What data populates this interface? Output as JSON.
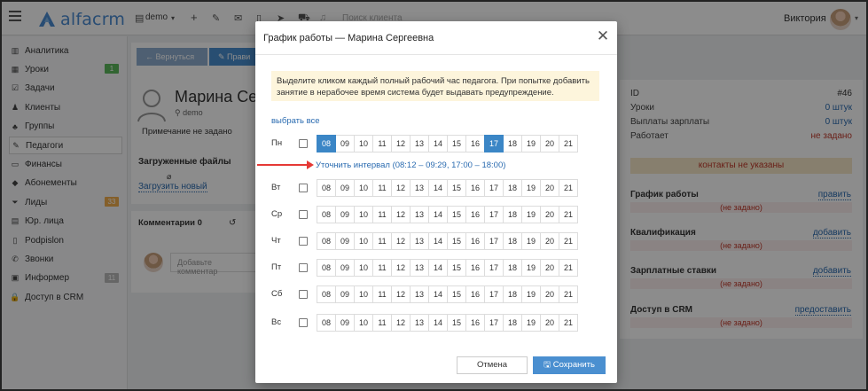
{
  "topbar": {
    "logo_text": "alfacrm",
    "branch": "demo",
    "search_placeholder": "Поиск клиента",
    "user_name": "Виктория"
  },
  "sidebar": {
    "items": [
      {
        "label": "Аналитика",
        "icon": "chart-icon"
      },
      {
        "label": "Уроки",
        "icon": "calendar-icon",
        "badge": "1",
        "badge_color": "#5cb85c"
      },
      {
        "label": "Задачи",
        "icon": "tasks-icon"
      },
      {
        "label": "Клиенты",
        "icon": "user-icon"
      },
      {
        "label": "Группы",
        "icon": "group-icon"
      },
      {
        "label": "Педагоги",
        "icon": "teacher-icon",
        "active": true
      },
      {
        "label": "Финансы",
        "icon": "money-icon"
      },
      {
        "label": "Абонементы",
        "icon": "tag-icon"
      },
      {
        "label": "Лиды",
        "icon": "funnel-icon",
        "badge": "33",
        "badge_color": "#f0ad4e"
      },
      {
        "label": "Юр. лица",
        "icon": "building-icon"
      },
      {
        "label": "Podpislon",
        "icon": "document-icon"
      },
      {
        "label": "Звонки",
        "icon": "phone-icon"
      },
      {
        "label": "Информер",
        "icon": "inbox-icon",
        "badge": "11",
        "badge_color": "#bbbbbb"
      },
      {
        "label": "Доступ в CRM",
        "icon": "lock-icon"
      }
    ]
  },
  "profile": {
    "back_label": "← Вернуться",
    "edit_label": "✎ Прави",
    "name": "Марина Сер",
    "branch": "demo",
    "note": "Примечание не задано",
    "files_title": "Загруженные файлы",
    "upload_link": "Загрузить новый",
    "comments_tab": "Комментарии 0",
    "comment_placeholder": "Добавьте комментар"
  },
  "right_panel": {
    "id_label": "ID",
    "id_value": "#46",
    "lessons_label": "Уроки",
    "lessons_value": "0 штук",
    "salary_label": "Выплаты зарплаты",
    "salary_value": "0 штук",
    "works_label": "Работает",
    "works_value": "не задано",
    "contacts_warning": "контакты не указаны",
    "sections": [
      {
        "title": "График работы",
        "action": "править",
        "empty": "(не задано)"
      },
      {
        "title": "Квалификация",
        "action": "добавить",
        "empty": "(не задано)"
      },
      {
        "title": "Зарплатные ставки",
        "action": "добавить",
        "empty": "(не задано)"
      },
      {
        "title": "Доступ в CRM",
        "action": "предоставить",
        "empty": "(не задано)"
      }
    ]
  },
  "modal": {
    "title": "График работы — Марина Сергеевна",
    "alert_text": "Выделите кликом каждый полный рабочий час педагога. При попытке добавить занятие в нерабочее время система будет выдавать предупреждение.",
    "select_all": "выбрать все",
    "interval_link": "Уточнить интервал (08:12 – 09:29, 17:00 – 18:00)",
    "hours": [
      "08",
      "09",
      "10",
      "11",
      "12",
      "13",
      "14",
      "15",
      "16",
      "17",
      "18",
      "19",
      "20",
      "21"
    ],
    "days": [
      {
        "label": "Пн",
        "selected": [
          "08",
          "17"
        ]
      },
      {
        "label": "Вт",
        "selected": []
      },
      {
        "label": "Ср",
        "selected": []
      },
      {
        "label": "Чт",
        "selected": []
      },
      {
        "label": "Пт",
        "selected": []
      },
      {
        "label": "Сб",
        "selected": []
      },
      {
        "label": "Вс",
        "selected": []
      }
    ],
    "cancel_label": "Отмена",
    "save_label": "Сохранить",
    "save_icon": "floppy-icon"
  },
  "colors": {
    "accent": "#3b86c6",
    "link": "#2a6bb0",
    "arrow": "#e53935"
  }
}
